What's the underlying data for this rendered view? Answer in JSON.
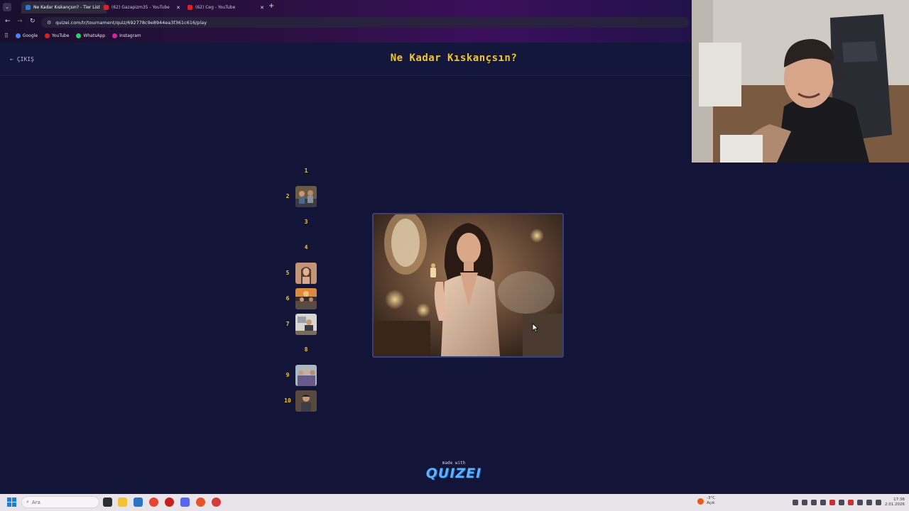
{
  "browser": {
    "tabs": [
      {
        "label": "Ne Kadar Kıskançsın? - Tier List",
        "active": true,
        "icon_color": "#2b7bd6"
      },
      {
        "label": "(62) Gazapizm35 - YouTube",
        "active": false,
        "icon_color": "#e02020"
      },
      {
        "label": "(62) Ceg - YouTube",
        "active": false,
        "icon_color": "#e02020"
      }
    ],
    "url": "quizei.com/tr/tournament/quiz/692778c9e8944ea3f361c616/play",
    "bookmarks": [
      {
        "label": "Google",
        "color": "#4285f4"
      },
      {
        "label": "YouTube",
        "color": "#e02020"
      },
      {
        "label": "WhatsApp",
        "color": "#25d366"
      },
      {
        "label": "Instagram",
        "color": "#d6249f"
      }
    ]
  },
  "page": {
    "exit_label": "ÇIKIŞ",
    "title": "Ne Kadar Kıskançsın?",
    "ranks": [
      {
        "num": "1",
        "filled": false
      },
      {
        "num": "2",
        "filled": true,
        "thumb": "people-around-table"
      },
      {
        "num": "3",
        "filled": false
      },
      {
        "num": "4",
        "filled": false
      },
      {
        "num": "5",
        "filled": true,
        "thumb": "woman-portrait"
      },
      {
        "num": "6",
        "filled": true,
        "thumb": "couple-dinner"
      },
      {
        "num": "7",
        "filled": true,
        "thumb": "man-at-desk"
      },
      {
        "num": "8",
        "filled": false
      },
      {
        "num": "9",
        "filled": true,
        "thumb": "friends-group"
      },
      {
        "num": "10",
        "filled": true,
        "thumb": "man-portrait"
      }
    ],
    "current_item": "woman-with-perfume-in-satin-robe",
    "footer_made_with": "made with",
    "footer_logo": "QUIZEI"
  },
  "taskbar": {
    "search_placeholder": "Ara",
    "weather_temp": "-3°C",
    "weather_desc": "Açık",
    "time": "17:36",
    "date": "2.01.2026"
  },
  "colors": {
    "accent": "#f6c52a",
    "background": "#121438",
    "logo": "#5ab2ff"
  }
}
